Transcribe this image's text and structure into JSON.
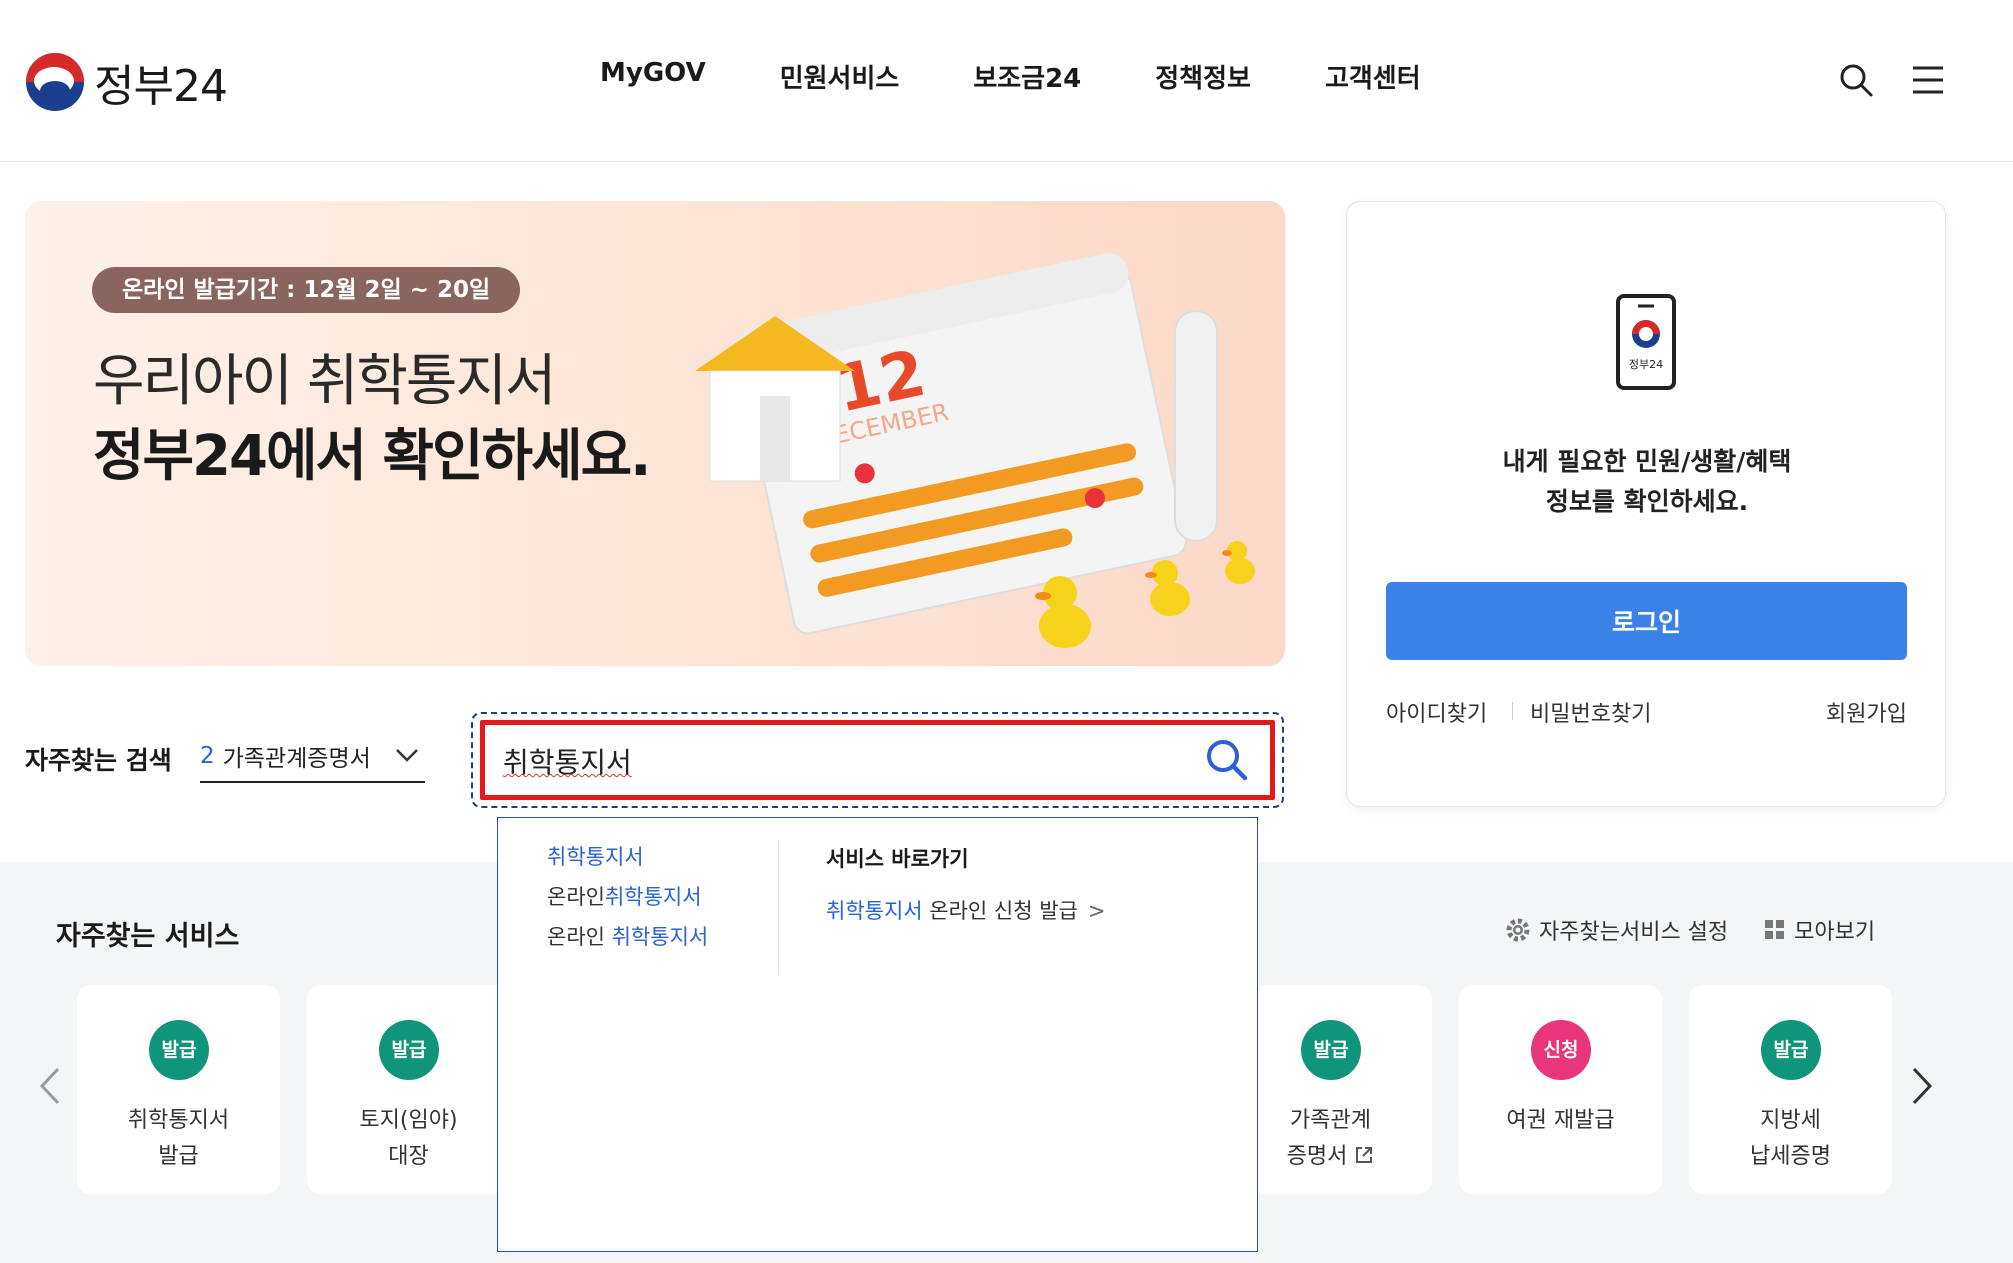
{
  "header": {
    "logo_text": "정부24",
    "nav": [
      "MyGOV",
      "민원서비스",
      "보조금24",
      "정책정보",
      "고객센터"
    ]
  },
  "banner": {
    "badge": "온라인 발급기간 : 12월 2일 ~ 20일",
    "line1": "우리아이 취학통지서",
    "line2": "정부24에서 확인하세요.",
    "calendar_month": "12",
    "calendar_label": "DECEMBER"
  },
  "frequent_search": {
    "label": "자주찾는 검색",
    "rank": "2",
    "value": "가족관계증명서"
  },
  "search": {
    "value": "취학통지서"
  },
  "dropdown": {
    "suggestions": [
      {
        "pre": "",
        "hl": "취학통지서",
        "post": ""
      },
      {
        "pre": "온라인",
        "hl": "취학통지서",
        "post": ""
      },
      {
        "pre": "온라인 ",
        "hl": "취학통지서",
        "post": ""
      }
    ],
    "shortcut_title": "서비스 바로가기",
    "shortcut_hl": "취학통지서",
    "shortcut_rest": " 온라인 신청 발급",
    "shortcut_arrow": ">"
  },
  "login": {
    "phone_label": "정부24",
    "message_line1": "내게 필요한 민원/생활/혜택",
    "message_line2": "정보를 확인하세요.",
    "button": "로그인",
    "find_id": "아이디찾기",
    "find_pw": "비밀번호찾기",
    "join": "회원가입"
  },
  "services": {
    "title": "자주찾는 서비스",
    "settings": "자주찾는서비스 설정",
    "view_all": "모아보기",
    "cards": [
      {
        "badge": "발급",
        "color": "#10957a",
        "line1": "취학통지서",
        "line2": "발급"
      },
      {
        "badge": "발급",
        "color": "#10957a",
        "line1": "토지(임야)",
        "line2": "대장"
      },
      {
        "badge": "발급",
        "color": "#10957a",
        "line1": "가족관계",
        "line2": "증명서"
      },
      {
        "badge": "신청",
        "color": "#e8357c",
        "line1": "여권 재발급",
        "line2": ""
      },
      {
        "badge": "발급",
        "color": "#10957a",
        "line1": "지방세",
        "line2": "납세증명"
      }
    ]
  },
  "colors": {
    "accent_blue": "#3b82e8",
    "highlight_blue": "#2a62d3",
    "search_border": "#e21a1a"
  }
}
